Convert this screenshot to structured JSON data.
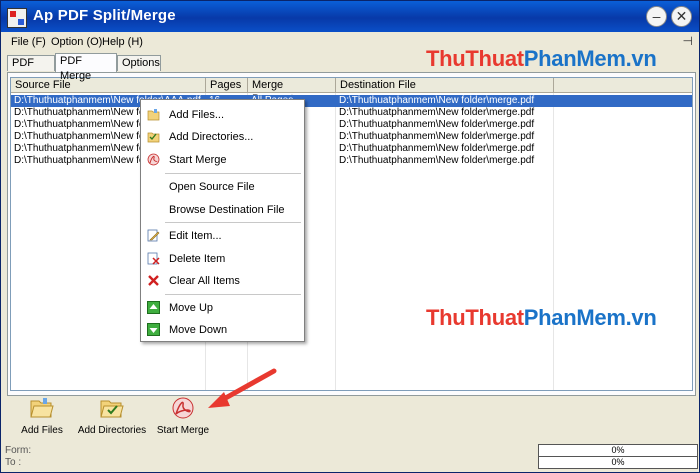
{
  "window": {
    "title": "Ap PDF Split/Merge"
  },
  "menu": [
    {
      "label": "File (F)"
    },
    {
      "label": "Option (O)"
    },
    {
      "label": "Help (H)"
    }
  ],
  "tabs": [
    {
      "label": "PDF Split"
    },
    {
      "label": "PDF Merge"
    },
    {
      "label": "Options"
    }
  ],
  "table": {
    "columns": [
      "Source File",
      "Pages",
      "Merge Parameters",
      "Destination File"
    ],
    "rows": [
      {
        "source": "D:\\Thuthuatphanmem\\New folder\\AAA.pdf",
        "pages": "16",
        "params": "All Pages",
        "dest": "D:\\Thuthuatphanmem\\New folder\\merge.pdf"
      },
      {
        "source": "D:\\Thuthuatphanmem\\New folder\\",
        "pages": "",
        "params": "",
        "dest": "D:\\Thuthuatphanmem\\New folder\\merge.pdf"
      },
      {
        "source": "D:\\Thuthuatphanmem\\New folder\\",
        "pages": "",
        "params": "",
        "dest": "D:\\Thuthuatphanmem\\New folder\\merge.pdf"
      },
      {
        "source": "D:\\Thuthuatphanmem\\New folder\\",
        "pages": "",
        "params": "",
        "dest": "D:\\Thuthuatphanmem\\New folder\\merge.pdf"
      },
      {
        "source": "D:\\Thuthuatphanmem\\New folder\\",
        "pages": "",
        "params": "",
        "dest": "D:\\Thuthuatphanmem\\New folder\\merge.pdf"
      },
      {
        "source": "D:\\Thuthuatphanmem\\New folder\\",
        "pages": "",
        "params": "",
        "dest": "D:\\Thuthuatphanmem\\New folder\\merge.pdf"
      }
    ]
  },
  "context_menu": [
    {
      "label": "Add Files...",
      "icon": "folder-open-icon"
    },
    {
      "label": "Add Directories...",
      "icon": "folder-check-icon"
    },
    {
      "label": "Start Merge",
      "icon": "acrobat-icon"
    },
    {
      "label": "Open Source File",
      "icon": ""
    },
    {
      "label": "Browse Destination File",
      "icon": ""
    },
    {
      "label": "Edit Item...",
      "icon": "edit-icon"
    },
    {
      "label": "Delete Item",
      "icon": "delete-doc-icon"
    },
    {
      "label": "Clear All Items",
      "icon": "red-x-icon"
    },
    {
      "label": "Move Up",
      "icon": "green-up-icon"
    },
    {
      "label": "Move Down",
      "icon": "green-down-icon"
    }
  ],
  "toolbar": [
    {
      "label": "Add Files",
      "icon": "folder-open-icon"
    },
    {
      "label": "Add Directories",
      "icon": "folder-check-icon"
    },
    {
      "label": "Start Merge",
      "icon": "acrobat-icon"
    }
  ],
  "status": {
    "form_label": "Form:",
    "to_label": "To :",
    "progress1": "0%",
    "progress2": "0%"
  },
  "watermark": {
    "part1": "ThuThuat",
    "part2": "PhanMem",
    "part3": ".vn"
  },
  "colors": {
    "title_bar": "#0a4fc8",
    "selection": "#316ac5",
    "watermark_red": "#e8392f",
    "watermark_blue": "#1a73c8",
    "arrow": "#e8392f"
  }
}
